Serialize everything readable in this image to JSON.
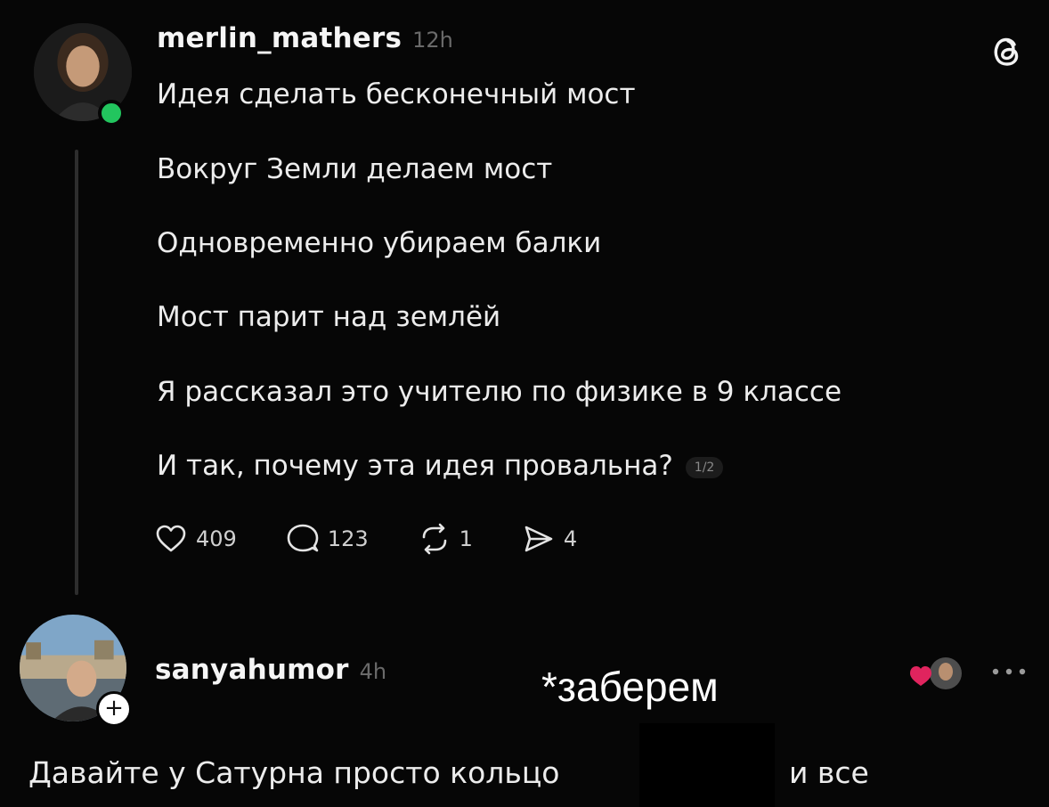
{
  "post": {
    "username": "merlin_mathers",
    "time": "12h",
    "lines": [
      "Идея сделать бесконечный мост",
      "Вокруг Земли делаем мост",
      "Одновременно убираем балки",
      "Мост парит над землёй",
      "Я рассказал это учителю по физике в 9 классе",
      "И так, почему эта идея провальна?"
    ],
    "page_indicator": "1/2",
    "stats": {
      "likes": "409",
      "comments": "123",
      "reposts": "1",
      "shares": "4"
    }
  },
  "reply": {
    "username": "sanyahumor",
    "time": "4h",
    "text_before": "Давайте у Сатурна просто кольцо",
    "text_after": "и все"
  },
  "overlay": {
    "caption": "*заберем"
  },
  "icons": {
    "threads_logo": "threads-logo-icon",
    "like": "heart-icon",
    "comment": "comment-icon",
    "repost": "repost-icon",
    "share": "send-icon",
    "more": "more-icon"
  },
  "colors": {
    "background": "#060606",
    "online": "#22c55e",
    "heart_red": "#e0245e"
  }
}
